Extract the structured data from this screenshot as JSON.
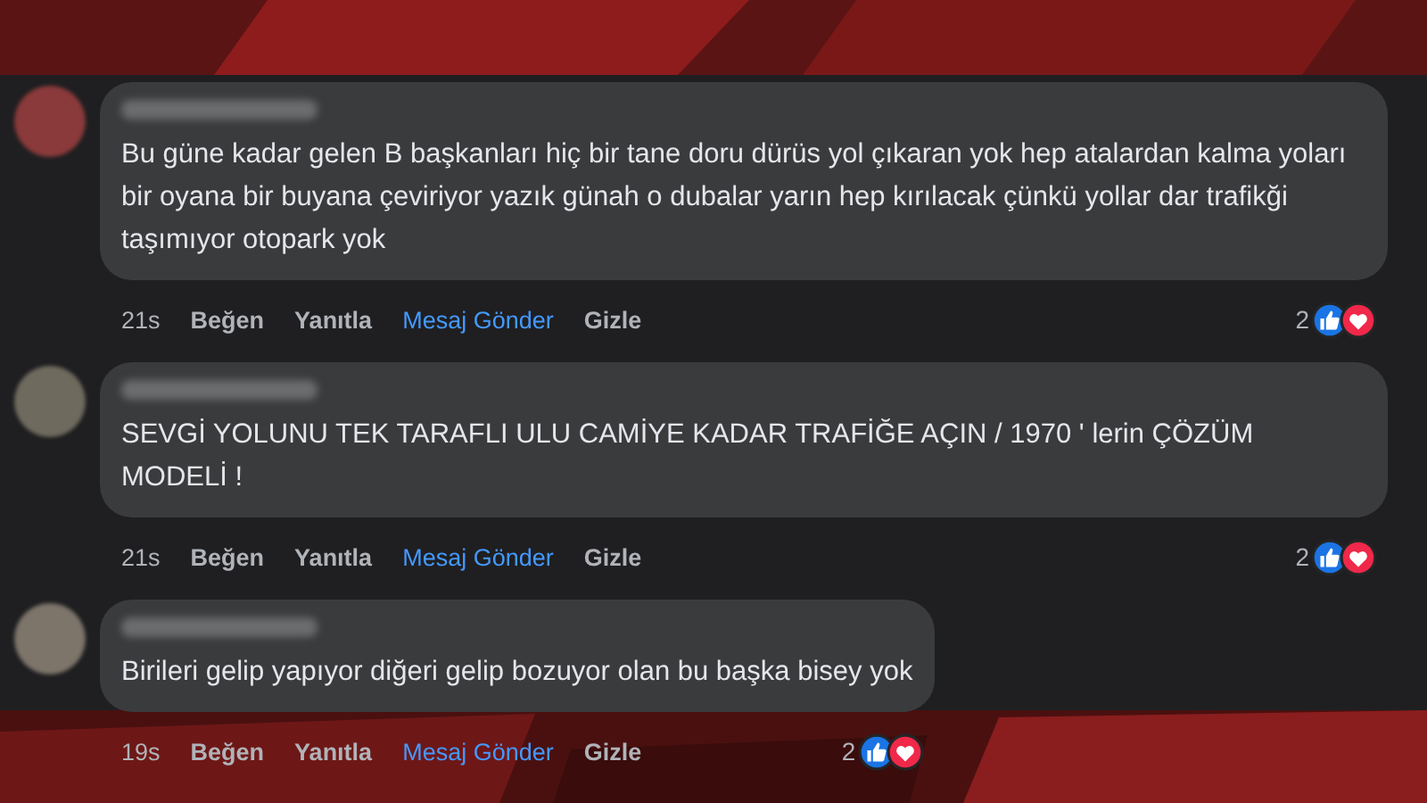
{
  "comments": [
    {
      "text": "Bu güne kadar gelen B başkanları hiç bir tane doru dürüs yol çıkaran yok hep atalardan kalma yoları bir oyana bir buyana çeviriyor yazık günah o dubalar yarın hep kırılacak çünkü yollar dar trafikği taşımıyor otopark yok",
      "time": "21s",
      "actions": [
        {
          "label": "Beğen",
          "highlighted": false
        },
        {
          "label": "Yanıtla",
          "highlighted": false
        },
        {
          "label": "Mesaj Gönder",
          "highlighted": true
        },
        {
          "label": "Gizle",
          "highlighted": false
        }
      ],
      "reaction_count": "2"
    },
    {
      "text": "SEVGİ YOLUNU TEK TARAFLI ULU CAMİYE KADAR TRAFİĞE AÇIN / 1970 ' lerin ÇÖZÜM MODELİ !",
      "time": "21s",
      "actions": [
        {
          "label": "Beğen",
          "highlighted": false
        },
        {
          "label": "Yanıtla",
          "highlighted": false
        },
        {
          "label": "Mesaj Gönder",
          "highlighted": true
        },
        {
          "label": "Gizle",
          "highlighted": false
        }
      ],
      "reaction_count": "2"
    },
    {
      "text": "Birileri gelip yapıyor diğeri gelip bozuyor olan bu başka bisey yok",
      "time": "19s",
      "actions": [
        {
          "label": "Beğen",
          "highlighted": false
        },
        {
          "label": "Yanıtla",
          "highlighted": false
        },
        {
          "label": "Mesaj Gönder",
          "highlighted": true
        },
        {
          "label": "Gizle",
          "highlighted": false
        }
      ],
      "reaction_count": "2"
    }
  ]
}
